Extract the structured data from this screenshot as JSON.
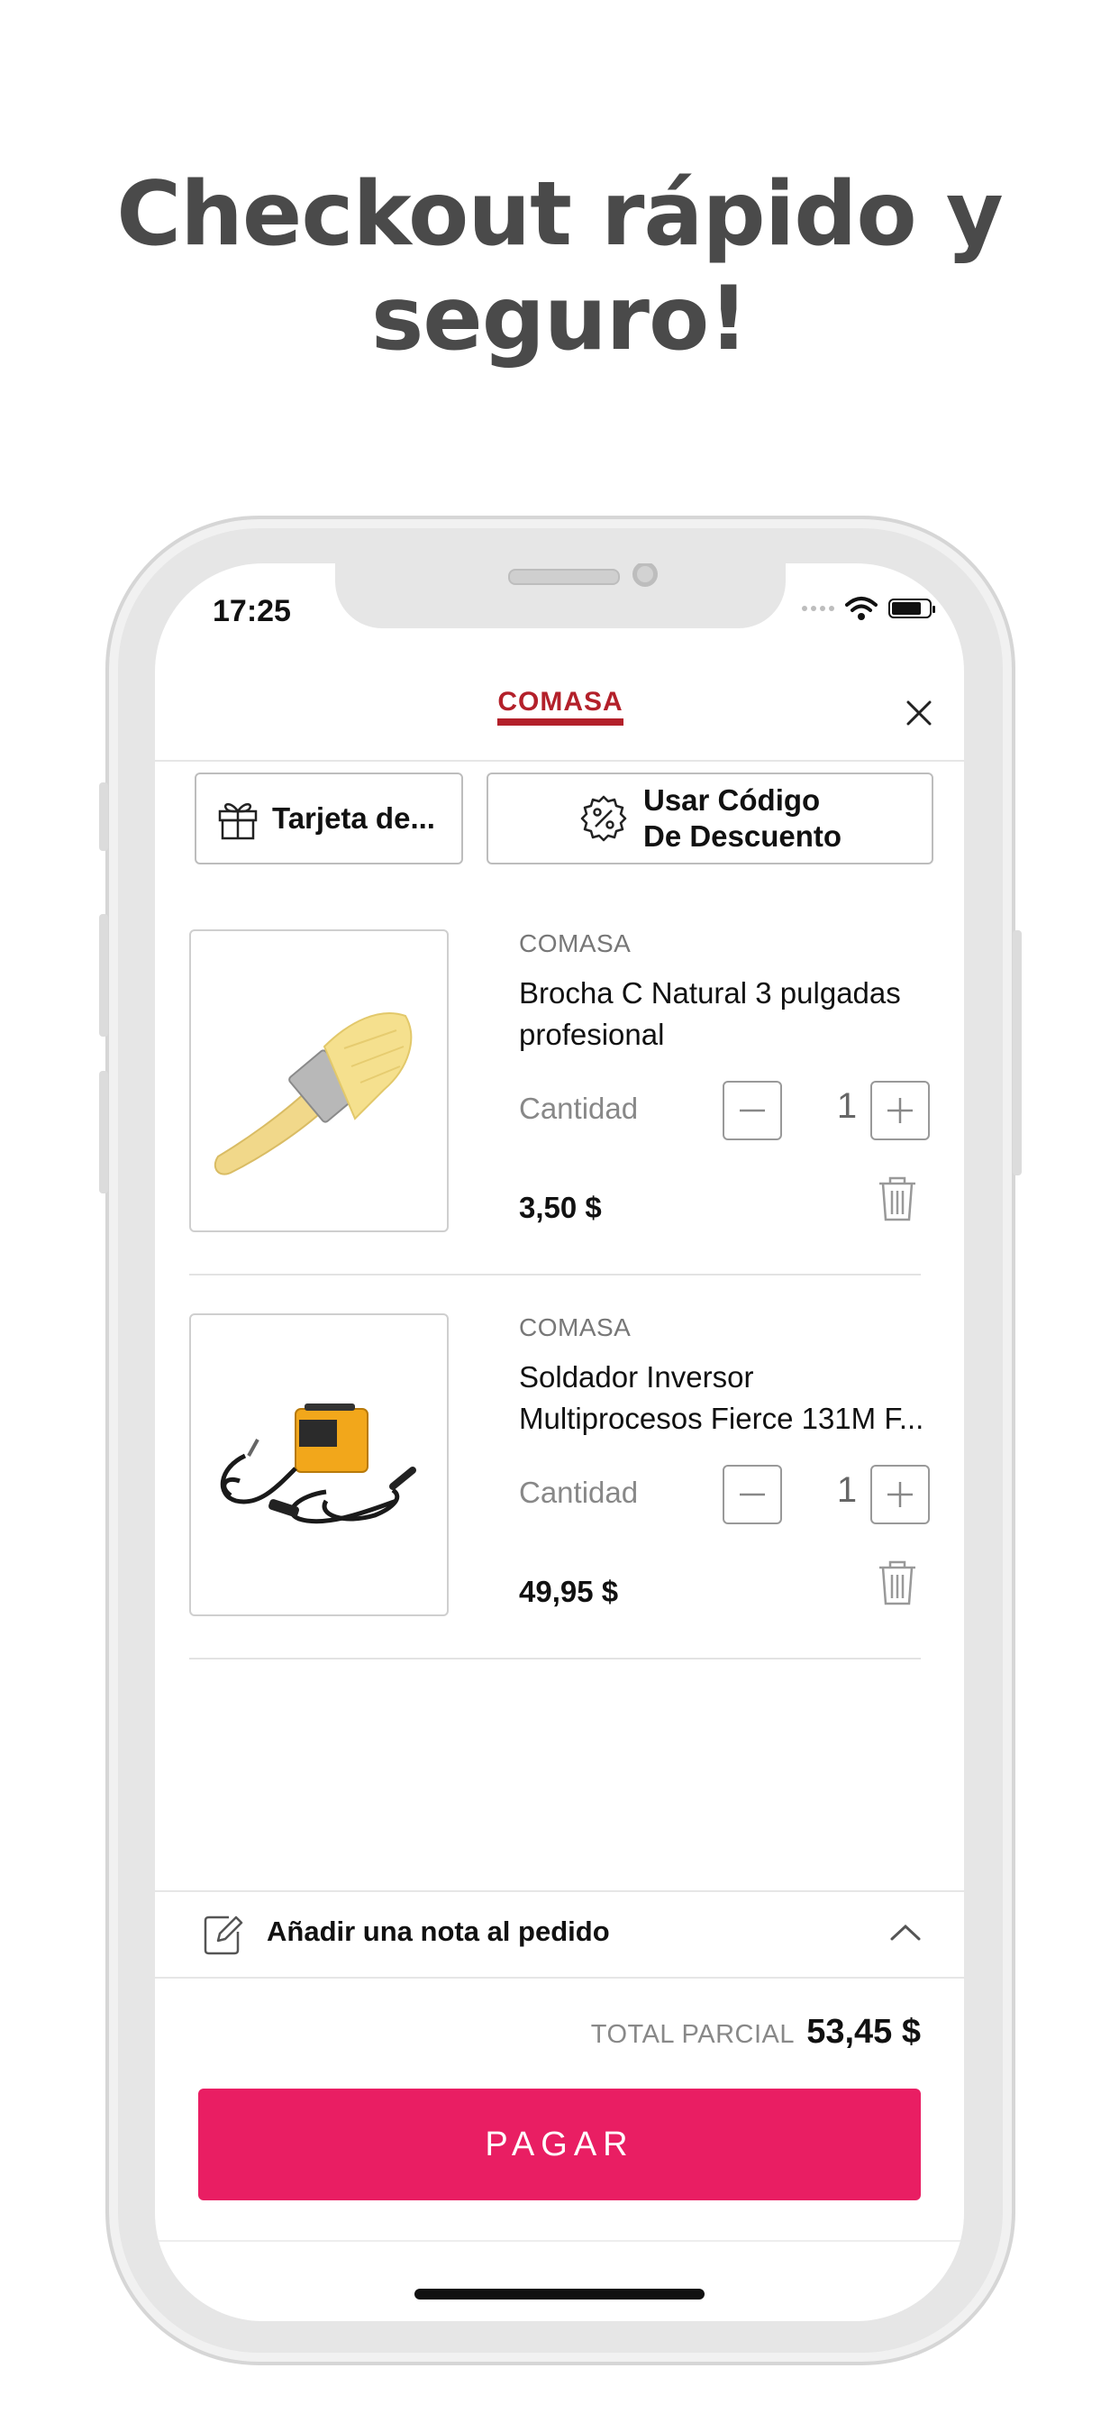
{
  "headline": {
    "line1": "Checkout rápido y",
    "line2": "seguro!"
  },
  "status_bar": {
    "time": "17:25"
  },
  "header": {
    "logo_text": "COMASA"
  },
  "promo": {
    "gift_card_label": "Tarjeta de...",
    "discount_line1": "Usar Código",
    "discount_line2": "De Descuento"
  },
  "cart": {
    "quantity_label": "Cantidad",
    "items": [
      {
        "brand": "COMASA",
        "name": "Brocha C Natural 3 pulgadas profesional",
        "quantity": "1",
        "price": "3,50 $"
      },
      {
        "brand": "COMASA",
        "name": "Soldador Inversor Multiprocesos Fierce 131M F...",
        "quantity": "1",
        "price": "49,95 $"
      }
    ]
  },
  "note": {
    "label": "Añadir una nota al pedido"
  },
  "summary": {
    "subtotal_label": "TOTAL PARCIAL",
    "subtotal_value": "53,45 $"
  },
  "actions": {
    "pay_label": "PAGAR"
  },
  "colors": {
    "accent": "#e91e63",
    "brand": "#b3202a",
    "headline": "#4a4a4a"
  }
}
